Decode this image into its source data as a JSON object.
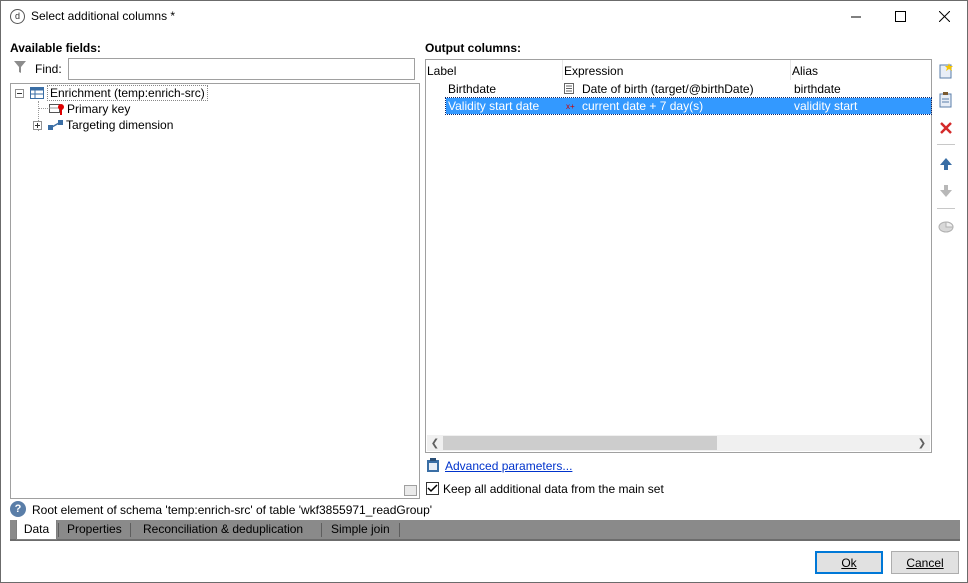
{
  "window": {
    "title": "Select additional columns *",
    "icon": "app-logo-icon"
  },
  "available_fields": {
    "heading": "Available fields:",
    "find_label": "Find:",
    "find_value": "",
    "tree": [
      {
        "label": "Enrichment (temp:enrich-src)",
        "icon": "table-icon",
        "expanded": true
      },
      {
        "label": "Primary key",
        "icon": "key-icon"
      },
      {
        "label": "Targeting dimension",
        "icon": "link-icon",
        "expanded": false
      }
    ]
  },
  "output_columns": {
    "heading": "Output columns:",
    "headers": [
      "Label",
      "Expression",
      "Alias"
    ],
    "rows": [
      {
        "label": "Birthdate",
        "expression": "Date of birth (target/@birthDate)",
        "alias": "birthdate",
        "selected": false
      },
      {
        "label": "Validity start date",
        "expression": "current date + 7 day(s)",
        "alias": "validity start",
        "selected": true
      }
    ]
  },
  "toolbar": {
    "buttons": [
      "add-icon",
      "edit-icon",
      "delete-icon",
      "move-up-icon",
      "move-down-icon",
      "distribution-icon"
    ]
  },
  "advanced_link": "Advanced parameters...",
  "keep_data": {
    "label": "Keep all additional data from the main set",
    "checked": true
  },
  "status": "Root element of schema 'temp:enrich-src' of table 'wkf3855971_readGroup'",
  "tabs": [
    "Data",
    "Properties",
    "Reconciliation & deduplication",
    "Simple join"
  ],
  "active_tab": "Data",
  "buttons": {
    "ok": "Ok",
    "cancel": "Cancel"
  }
}
